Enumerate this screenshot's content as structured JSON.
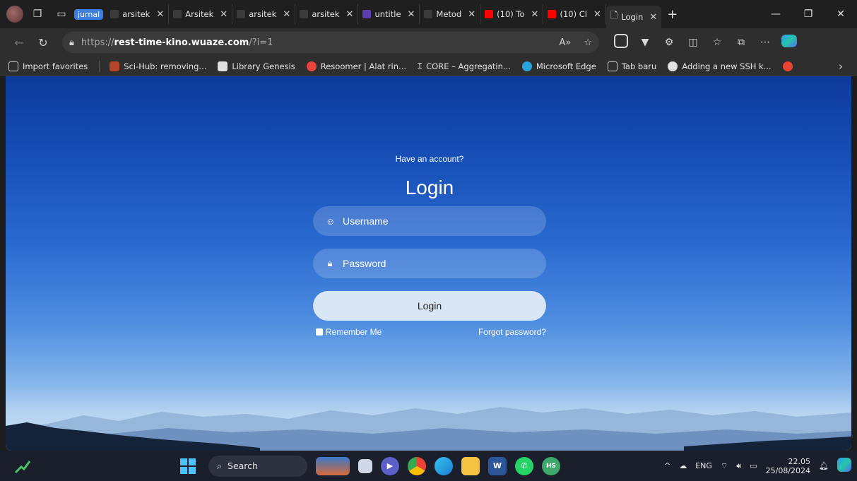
{
  "browser": {
    "tabs": [
      {
        "label": "jurnal",
        "kind": "group"
      },
      {
        "label": "arsitek",
        "kind": "tab",
        "favicon_color": "#3a3a3a"
      },
      {
        "label": "Arsitek",
        "kind": "tab",
        "favicon_color": "#3a3a3a"
      },
      {
        "label": "arsitek",
        "kind": "tab",
        "favicon_color": "#3a3a3a"
      },
      {
        "label": "arsitek",
        "kind": "tab",
        "favicon_color": "#3a3a3a"
      },
      {
        "label": "untitle",
        "kind": "tab",
        "favicon_color": "#5a3fb0"
      },
      {
        "label": "Metod",
        "kind": "tab",
        "favicon_color": "#3a3a3a"
      },
      {
        "label": "(10) To",
        "kind": "tab",
        "favicon_color": "#ff0000"
      },
      {
        "label": "(10) Cl",
        "kind": "tab",
        "favicon_color": "#ff0000"
      },
      {
        "label": "Login",
        "kind": "active",
        "favicon_color": "#d8d8d8"
      }
    ],
    "address": {
      "protocol": "https://",
      "host": "rest-time-kino.wuaze.com",
      "path": "/?i=1"
    },
    "favorites": [
      {
        "label": "Import favorites",
        "icon_color": "#cfcfcf"
      },
      {
        "label": "Sci-Hub: removing...",
        "icon_color": "#b5452b"
      },
      {
        "label": "Library Genesis",
        "icon_color": "#e0e0e0"
      },
      {
        "label": "Resoomer | Alat rin...",
        "icon_color": "#e8453c"
      },
      {
        "label": "CORE – Aggregatin...",
        "icon_color": "#d8d8d8"
      },
      {
        "label": "Microsoft Edge",
        "icon_color": "#2aa3d8"
      },
      {
        "label": "Tab baru",
        "icon_color": "#cfcfcf"
      },
      {
        "label": "Adding a new SSH k...",
        "icon_color": "#e0e0e0"
      },
      {
        "label": "",
        "icon_color": "#ea4335"
      }
    ]
  },
  "page": {
    "have_account": "Have an account?",
    "title": "Login",
    "username_placeholder": "Username",
    "password_placeholder": "Password",
    "login_button": "Login",
    "remember_me": "Remember Me",
    "forgot_password": "Forgot password?"
  },
  "taskbar": {
    "search_label": "Search",
    "language": "ENG",
    "time": "22.05",
    "date": "25/08/2024",
    "apps": [
      {
        "name": "landscape-widget-icon",
        "color": "#d66a3b"
      },
      {
        "name": "task-view-icon",
        "color": "#cfd8e6"
      },
      {
        "name": "meet-icon",
        "color": "#5b5fc7"
      },
      {
        "name": "chrome-icon",
        "color": "#ea4335"
      },
      {
        "name": "edge-icon",
        "color": "#1fa0d9"
      },
      {
        "name": "file-explorer-icon",
        "color": "#f5c242"
      },
      {
        "name": "word-icon",
        "color": "#2b579a"
      },
      {
        "name": "whatsapp-icon",
        "color": "#25d366"
      },
      {
        "name": "hs-app-icon",
        "color": "#3ea86b"
      }
    ]
  }
}
